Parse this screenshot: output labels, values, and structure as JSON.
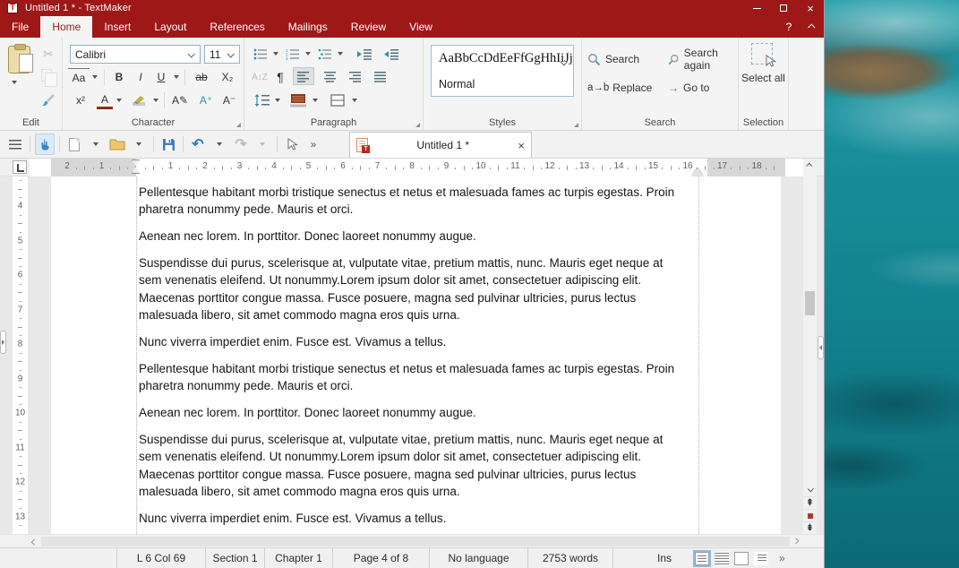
{
  "window": {
    "title": "Untitled 1 * - TextMaker",
    "app_icon_letter": "T"
  },
  "menu": {
    "tabs": [
      {
        "label": "File"
      },
      {
        "label": "Home",
        "active": true
      },
      {
        "label": "Insert"
      },
      {
        "label": "Layout"
      },
      {
        "label": "References"
      },
      {
        "label": "Mailings"
      },
      {
        "label": "Review"
      },
      {
        "label": "View"
      }
    ],
    "help": "?"
  },
  "ribbon": {
    "edit": {
      "label": "Edit",
      "cut_icon": "✂"
    },
    "character": {
      "label": "Character",
      "font_name": "Calibri",
      "font_size": "11",
      "case_btn": "Aa",
      "bold": "B",
      "italic": "I",
      "underline": "U",
      "strikethrough": "ab",
      "subscript": "X₂",
      "superscript": "x²",
      "font_color": "A",
      "char_style": "A✎",
      "grow_font": "A⁺",
      "shrink_font": "A⁻"
    },
    "paragraph": {
      "label": "Paragraph",
      "pilcrow": "¶",
      "sort": "A↕Z"
    },
    "styles": {
      "label": "Styles",
      "preview": "AaBbCcDdEeFfGgHhIiJj",
      "style_name": "Normal"
    },
    "search": {
      "label": "Search",
      "search": "Search",
      "search_again": "Search again",
      "replace": "Replace",
      "replace_icon": "a→b",
      "goto": "Go to",
      "goto_icon": "→"
    },
    "selection": {
      "label": "Selection",
      "select_all": "Select all"
    }
  },
  "toolbar": {
    "undo_icon": "↶",
    "redo_icon": "↷",
    "overflow": "»",
    "tab": {
      "title": "Untitled 1 *",
      "close": "×"
    }
  },
  "ruler": {
    "h_left_numbers": [
      2,
      1
    ],
    "h_numbers": [
      1,
      2,
      3,
      4,
      5,
      6,
      7,
      8,
      9,
      10,
      11,
      12,
      13,
      14,
      15,
      16,
      17,
      18
    ],
    "v_numbers": [
      4,
      5,
      6,
      7,
      8,
      9,
      10,
      11,
      12,
      13
    ]
  },
  "document": {
    "paragraphs": [
      "Pellentesque habitant morbi tristique senectus et netus et malesuada fames ac turpis egestas. Proin pharetra nonummy pede. Mauris et orci.",
      "Aenean nec lorem. In porttitor. Donec laoreet nonummy augue.",
      "Suspendisse dui purus, scelerisque at, vulputate vitae, pretium mattis, nunc. Mauris eget neque at sem venenatis eleifend. Ut nonummy.Lorem ipsum dolor sit amet, consectetuer adipiscing elit. Maecenas porttitor congue massa. Fusce posuere, magna sed pulvinar ultricies, purus lectus malesuada libero, sit amet commodo magna eros quis urna.",
      "Nunc viverra imperdiet enim. Fusce est. Vivamus a tellus.",
      "Pellentesque habitant morbi tristique senectus et netus et malesuada fames ac turpis egestas. Proin pharetra nonummy pede. Mauris et orci.",
      "Aenean nec lorem. In porttitor. Donec laoreet nonummy augue.",
      "Suspendisse dui purus, scelerisque at, vulputate vitae, pretium mattis, nunc. Mauris eget neque at sem venenatis eleifend. Ut nonummy.Lorem ipsum dolor sit amet, consectetuer adipiscing elit. Maecenas porttitor congue massa. Fusce posuere, magna sed pulvinar ultricies, purus lectus malesuada libero, sit amet commodo magna eros quis urna.",
      "Nunc viverra imperdiet enim. Fusce est. Vivamus a tellus."
    ]
  },
  "statusbar": {
    "cursor_pos": "L 6 Col 69",
    "section": "Section 1",
    "chapter": "Chapter 1",
    "page": "Page 4 of 8",
    "language": "No language",
    "words": "2753 words",
    "insert_mode": "Ins",
    "overflow": "»"
  },
  "colors": {
    "accent_red": "#9e1818",
    "icon_blue": "#3a87c8",
    "icon_teal": "#2e8fa6",
    "shade_red": "#8c3a14"
  }
}
